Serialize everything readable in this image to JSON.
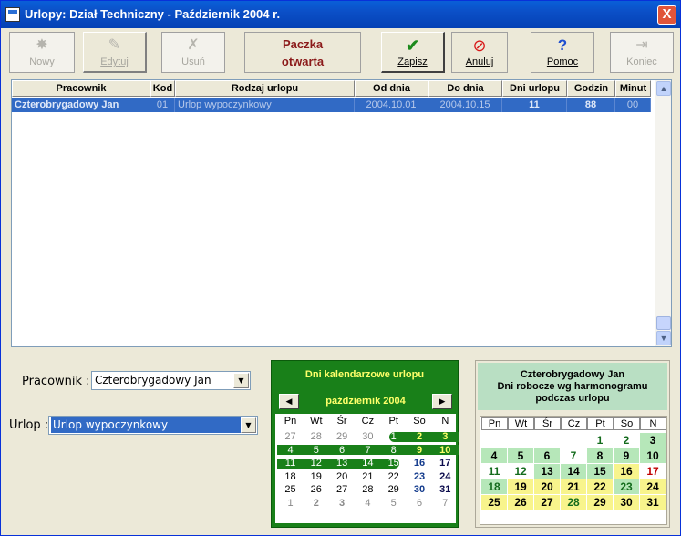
{
  "window": {
    "title": "Urlopy: Dział Techniczny - Październik 2004 r.",
    "close": "X"
  },
  "toolbar": {
    "new_label": "Nowy",
    "edit_label": "Edytuj",
    "delete_label": "Usuń",
    "batch_line1": "Paczka",
    "batch_line2": "otwarta",
    "save_label": "Zapisz",
    "cancel_label": "Anuluj",
    "help_label": "Pomoc",
    "end_label": "Koniec",
    "save_icon": "✔",
    "cancel_icon": "⊘",
    "help_icon": "?"
  },
  "grid": {
    "columns": [
      "Pracownik",
      "Kod",
      "Rodzaj urlopu",
      "Od dnia",
      "Do dnia",
      "Dni urlopu",
      "Godzin",
      "Minut"
    ],
    "rows": [
      {
        "employee": "Czterobrygadowy Jan",
        "code": "01",
        "type": "Urlop wypoczynkowy",
        "from": "2004.10.01",
        "to": "2004.10.15",
        "days": "11",
        "hours": "88",
        "minutes": "00"
      }
    ]
  },
  "form": {
    "employee_label": "Pracownik :",
    "employee_value": "Czterobrygadowy Jan",
    "leave_label": "Urlop :",
    "leave_value": "Urlop wypoczynkowy"
  },
  "calendar": {
    "header": "Dni kalendarzowe urlopu",
    "month": "październik 2004",
    "weekdays": [
      "Pn",
      "Wt",
      "Śr",
      "Cz",
      "Pt",
      "So",
      "N"
    ],
    "weeks": [
      [
        "27",
        "28",
        "29",
        "30",
        "1",
        "2",
        "3"
      ],
      [
        "4",
        "5",
        "6",
        "7",
        "8",
        "9",
        "10"
      ],
      [
        "11",
        "12",
        "13",
        "14",
        "15",
        "16",
        "17"
      ],
      [
        "18",
        "19",
        "20",
        "21",
        "22",
        "23",
        "24"
      ],
      [
        "25",
        "26",
        "27",
        "28",
        "29",
        "30",
        "31"
      ],
      [
        "1",
        "2",
        "3",
        "4",
        "5",
        "6",
        "7"
      ]
    ],
    "leave_from": 1,
    "leave_to": 15
  },
  "work_calendar": {
    "title_line1": "Czterobrygadowy Jan",
    "title_line2": "Dni robocze wg harmonogramu",
    "title_line3": "podczas urlopu",
    "weekdays": [
      "Pn",
      "Wt",
      "Śr",
      "Cz",
      "Pt",
      "So",
      "N"
    ],
    "weeks": [
      [
        "",
        "",
        "",
        "",
        "1",
        "2",
        "3"
      ],
      [
        "4",
        "5",
        "6",
        "7",
        "8",
        "9",
        "10"
      ],
      [
        "11",
        "12",
        "13",
        "14",
        "15",
        "16",
        "17"
      ],
      [
        "18",
        "19",
        "20",
        "21",
        "22",
        "23",
        "24"
      ],
      [
        "25",
        "26",
        "27",
        "28",
        "29",
        "30",
        "31"
      ]
    ]
  },
  "colors": {
    "selection": "#316ac5",
    "calendar_green": "#198019",
    "work_green": "#b6e7b9",
    "work_yellow": "#f8f48c"
  }
}
